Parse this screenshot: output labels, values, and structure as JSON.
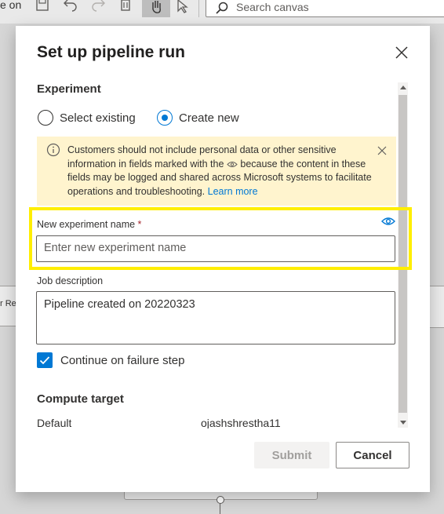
{
  "toolbar": {
    "partial_label": "e on",
    "search_placeholder": "Search canvas"
  },
  "background": {
    "partial_node_text": "r Re"
  },
  "dialog": {
    "title": "Set up pipeline run",
    "experiment": {
      "section_title": "Experiment",
      "options": [
        {
          "label": "Select existing",
          "selected": false
        },
        {
          "label": "Create new",
          "selected": true
        }
      ]
    },
    "warning": {
      "text_before_icon": "Customers should not include personal data or other sensitive information in fields marked with the",
      "text_after_icon": "because the content in these fields may be logged and shared across Microsoft systems to facilitate operations and troubleshooting.",
      "link": "Learn more",
      "color": "#fff4ce"
    },
    "experiment_name": {
      "label": "New experiment name",
      "required_marker": "*",
      "placeholder": "Enter new experiment name",
      "value": ""
    },
    "job_description": {
      "label": "Job description",
      "value": "Pipeline created on 20220323"
    },
    "continue_on_failure": {
      "label": "Continue on failure step",
      "checked": true
    },
    "compute": {
      "section_title": "Compute target",
      "row_label": "Default",
      "row_value": "ojashshrestha11"
    },
    "buttons": {
      "submit": "Submit",
      "cancel": "Cancel"
    },
    "icons": {
      "close": "close-icon",
      "info": "info-icon",
      "eye": "eye-icon",
      "check": "checkmark-icon"
    },
    "colors": {
      "accent": "#0078d4",
      "highlight": "#ffee00",
      "required": "#a4262c"
    }
  }
}
